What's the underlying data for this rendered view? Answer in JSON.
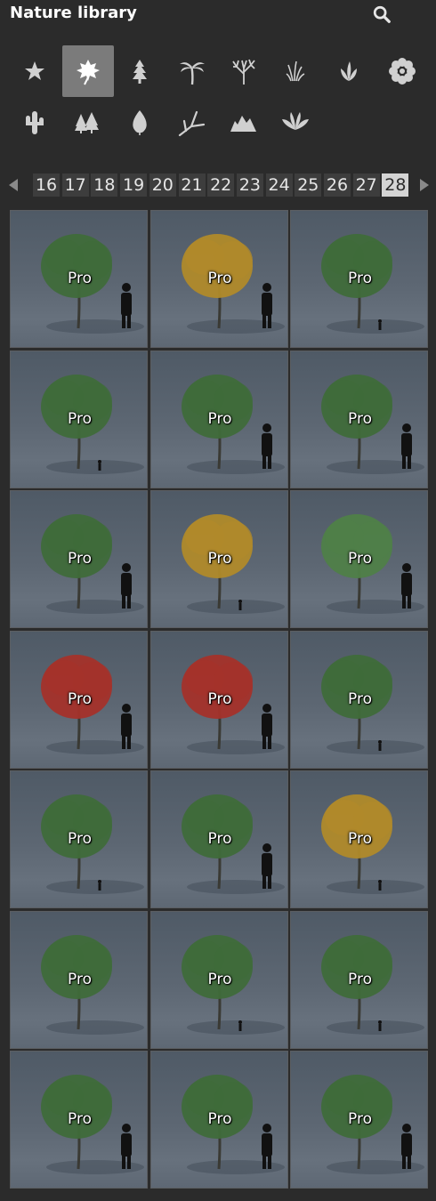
{
  "header": {
    "title": "Nature library",
    "search_icon": "search-icon"
  },
  "categories": [
    {
      "name": "favorites",
      "icon": "star-icon",
      "active": false
    },
    {
      "name": "leaf",
      "icon": "leaf-icon",
      "active": true
    },
    {
      "name": "conifer",
      "icon": "conifer-icon",
      "active": false
    },
    {
      "name": "palm",
      "icon": "palm-icon",
      "active": false
    },
    {
      "name": "bare-tree",
      "icon": "bare-tree-icon",
      "active": false
    },
    {
      "name": "grass",
      "icon": "grass-icon",
      "active": false
    },
    {
      "name": "plant",
      "icon": "plant-icon",
      "active": false
    },
    {
      "name": "flower",
      "icon": "flower-icon",
      "active": false
    },
    {
      "name": "cactus",
      "icon": "cactus-icon",
      "active": false
    },
    {
      "name": "forest",
      "icon": "forest-icon",
      "active": false
    },
    {
      "name": "single-leaf",
      "icon": "single-leaf-icon",
      "active": false
    },
    {
      "name": "branch",
      "icon": "branch-icon",
      "active": false
    },
    {
      "name": "rocks",
      "icon": "rocks-icon",
      "active": false
    },
    {
      "name": "fern",
      "icon": "fern-icon",
      "active": false
    }
  ],
  "pagination": {
    "prev_icon": "chevron-left-icon",
    "next_icon": "chevron-right-icon",
    "pages": [
      "16",
      "17",
      "18",
      "19",
      "20",
      "21",
      "22",
      "23",
      "24",
      "25",
      "26",
      "27",
      "28"
    ],
    "active_page": "28"
  },
  "colors": {
    "green": "#3f6b3a",
    "yellow": "#b08a2a",
    "red": "#a4322a",
    "lightgreen": "#4f7f48",
    "sky": "#5b6672"
  },
  "tiles": [
    {
      "label": "Pro",
      "crown": "green",
      "person": "big"
    },
    {
      "label": "Pro",
      "crown": "yellow",
      "person": "big"
    },
    {
      "label": "Pro",
      "crown": "green",
      "person": "small"
    },
    {
      "label": "Pro",
      "crown": "green",
      "person": "small"
    },
    {
      "label": "Pro",
      "crown": "green",
      "person": "big"
    },
    {
      "label": "Pro",
      "crown": "green",
      "person": "big"
    },
    {
      "label": "Pro",
      "crown": "green",
      "person": "big"
    },
    {
      "label": "Pro",
      "crown": "yellow",
      "person": "small"
    },
    {
      "label": "Pro",
      "crown": "lightgreen",
      "person": "big"
    },
    {
      "label": "Pro",
      "crown": "red",
      "person": "big"
    },
    {
      "label": "Pro",
      "crown": "red",
      "person": "big"
    },
    {
      "label": "Pro",
      "crown": "green",
      "person": "small"
    },
    {
      "label": "Pro",
      "crown": "green",
      "person": "small"
    },
    {
      "label": "Pro",
      "crown": "green",
      "person": "big"
    },
    {
      "label": "Pro",
      "crown": "yellow",
      "person": "small"
    },
    {
      "label": "Pro",
      "crown": "green",
      "person": "none"
    },
    {
      "label": "Pro",
      "crown": "green",
      "person": "small"
    },
    {
      "label": "Pro",
      "crown": "green",
      "person": "small"
    },
    {
      "label": "Pro",
      "crown": "green",
      "person": "big"
    },
    {
      "label": "Pro",
      "crown": "green",
      "person": "big"
    },
    {
      "label": "Pro",
      "crown": "green",
      "person": "big"
    }
  ]
}
